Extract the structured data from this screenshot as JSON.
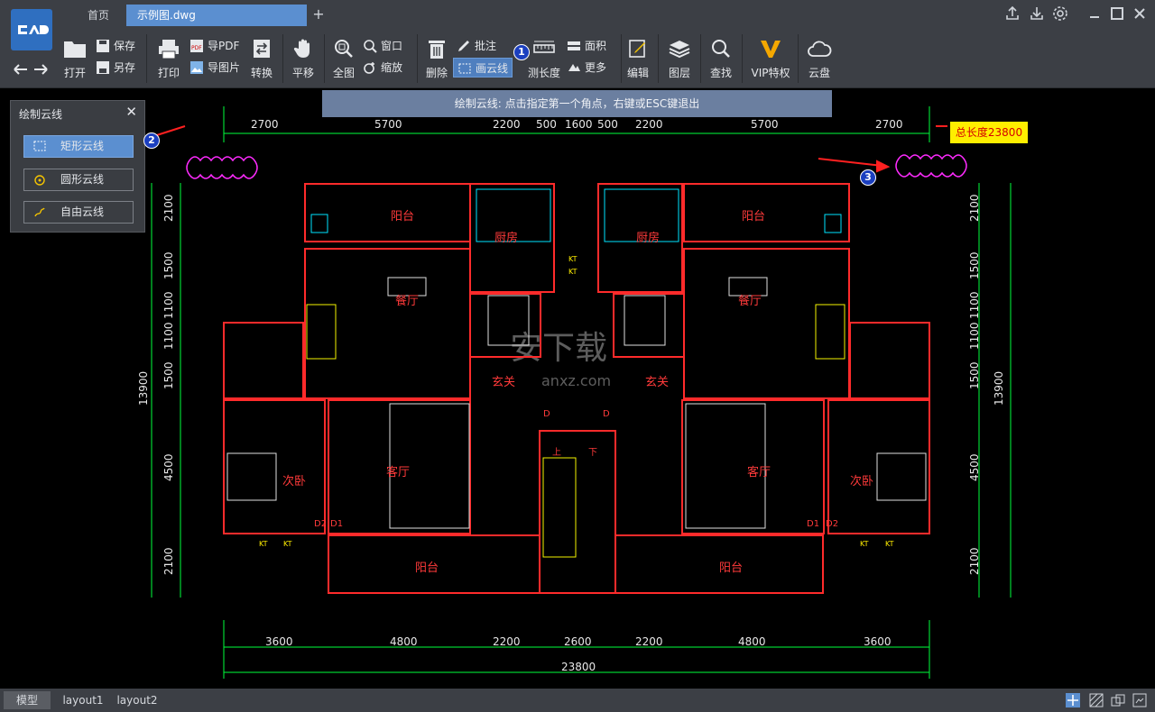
{
  "tabs": {
    "home": "首页",
    "file": "示例图.dwg",
    "add": "+"
  },
  "toolbar": {
    "open": "打开",
    "save": "保存",
    "save_as": "另存",
    "print": "打印",
    "export_pdf": "导PDF",
    "export_img": "导图片",
    "convert": "转换",
    "pan": "平移",
    "fit": "全图",
    "window": "窗口",
    "zoom": "缩放",
    "delete": "删除",
    "annotate": "批注",
    "cloud": "画云线",
    "measure": "测长度",
    "area": "面积",
    "more": "更多",
    "edit": "编辑",
    "layers": "图层",
    "find": "查找",
    "vip": "VIP特权",
    "cloud_disk": "云盘"
  },
  "hint": "绘制云线: 点击指定第一个角点，右键或ESC键退出",
  "panel": {
    "title": "绘制云线",
    "close": "✕",
    "rect": "矩形云线",
    "circle": "圆形云线",
    "free": "自由云线"
  },
  "note": "总长度23800",
  "badges": [
    "1",
    "2",
    "3"
  ],
  "drawing": {
    "dims_top": [
      "2700",
      "5700",
      "2200",
      "500",
      "1600",
      "500",
      "2200",
      "5700",
      "2700"
    ],
    "dims_bottom": [
      "3600",
      "4800",
      "2200",
      "2600",
      "2200",
      "4800",
      "3600"
    ],
    "total_bottom": "23800",
    "dims_left": [
      "2100",
      "1500",
      "1100",
      "1100",
      "1500",
      "4500",
      "2100"
    ],
    "dims_right": [
      "2100",
      "1500",
      "1100",
      "1100",
      "1500",
      "4500",
      "2100"
    ],
    "total_left": "13900",
    "total_right": "13900",
    "rooms": {
      "balcony": "阳台",
      "kitchen": "厨房",
      "dining": "餐厅",
      "entry": "玄关",
      "living": "客厅",
      "bedroom": "次卧",
      "up": "上",
      "down": "下",
      "d": "D",
      "d1": "D1",
      "d2": "D2",
      "kt": "KT"
    },
    "watermark": "安下载",
    "watermark_sub": "anxz.com"
  },
  "layouts": [
    "模型",
    "layout1",
    "layout2"
  ],
  "colors": {
    "accent": "#5b8fd0",
    "bg": "#3c3f45",
    "wall": "#ff2b2b",
    "dim": "#00ff3c",
    "cyan": "#00e5ff"
  }
}
